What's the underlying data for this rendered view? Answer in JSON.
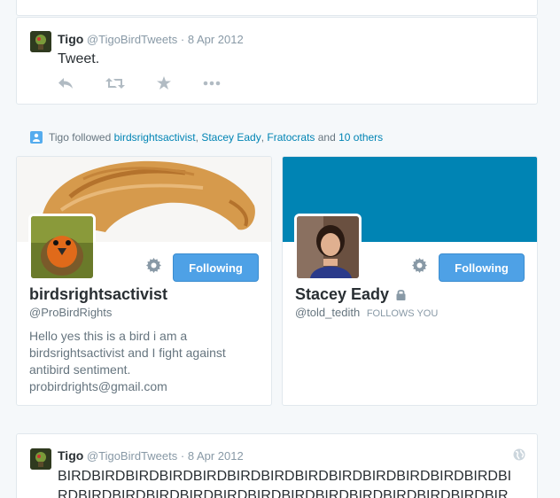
{
  "tweet1": {
    "name": "Tigo",
    "handle": "@TigoBirdTweets",
    "dot": "·",
    "date": "8 Apr 2012",
    "text": "Tweet."
  },
  "activity": {
    "prefix": "Tigo followed",
    "link1": "birdsrightsactivist",
    "sep1": ",",
    "link2": "Stacey Eady",
    "sep2": ",",
    "link3": "Fratocrats",
    "and": "and",
    "others": "10 others"
  },
  "user1": {
    "name": "birdsrightsactivist",
    "handle": "@ProBirdRights",
    "follow_label": "Following",
    "bio_line1": "Hello yes this is a bird i am a",
    "bio_line2": "birdsrightsactivist and I fight against",
    "bio_line3": "antibird sentiment.",
    "bio_line4": "probirdrights@gmail.com"
  },
  "user2": {
    "name": "Stacey Eady",
    "handle": "@told_tedith",
    "follows_you": "FOLLOWS YOU",
    "follow_label": "Following",
    "banner_color": "#0084b4"
  },
  "tweet2": {
    "name": "Tigo",
    "handle": "@TigoBirdTweets",
    "dot": "·",
    "date": "8 Apr 2012",
    "line1": "BIRDBIRDBIRDBIRDBIRDBIRDBIRDBIRDBIRDBIRDBIRDBIRDBIRDBI",
    "line2": "RDBIRDBIRDBIRDBIRDBIRDBIRDBIRDBIRDBIRDBIRDBIRDBIRDBIR"
  },
  "colors": {
    "accent": "#55acee",
    "link": "#0084b4",
    "button": "#4ea1e6"
  }
}
